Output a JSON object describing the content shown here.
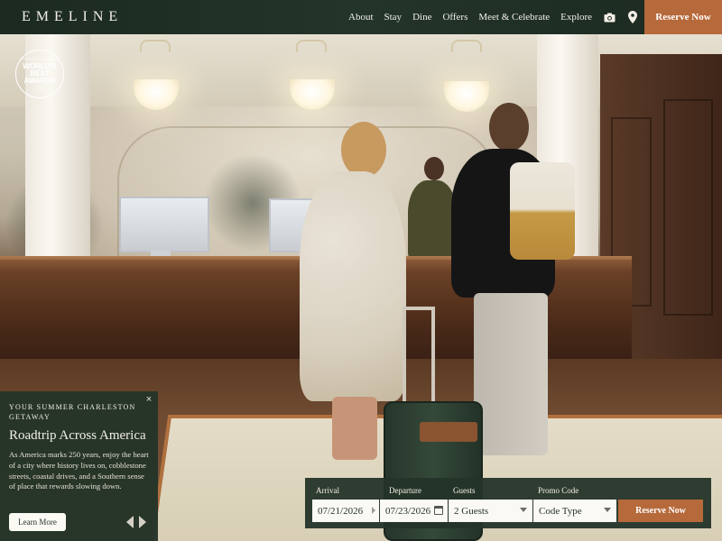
{
  "header": {
    "logo": "EMELINE",
    "nav": [
      {
        "label": "About"
      },
      {
        "label": "Stay"
      },
      {
        "label": "Dine"
      },
      {
        "label": "Offers"
      },
      {
        "label": "Meet & Celebrate"
      },
      {
        "label": "Explore"
      }
    ],
    "icons": [
      "camera-icon",
      "map-pin-icon"
    ],
    "reserve_label": "Reserve Now"
  },
  "award": {
    "line1": "TRAVEL+ LEISURE",
    "line2": "WORLD'S",
    "line3": "BEST",
    "line4": "AWARDS",
    "line5": "2025"
  },
  "promo": {
    "close_glyph": "×",
    "kicker": "Your Summer Charleston Getaway",
    "title": "Roadtrip Across America",
    "body": "As America marks 250 years, enjoy the heart of a city where history lives on, cobblestone streets, coastal drives, and a Southern sense of place that rewards slowing down.",
    "button_label": "Learn More"
  },
  "booking": {
    "arrival_label": "Arrival",
    "arrival_value": "07/21/2026",
    "departure_label": "Departure",
    "departure_value": "07/23/2026",
    "guests_label": "Guests",
    "guests_value": "2 Guests",
    "promo_label": "Promo Code",
    "promo_value": "Code Type",
    "reserve_label": "Reserve Now"
  },
  "colors": {
    "header_bg": "#1c2a21",
    "accent": "#b6693a",
    "panel_bg": "#243429"
  }
}
